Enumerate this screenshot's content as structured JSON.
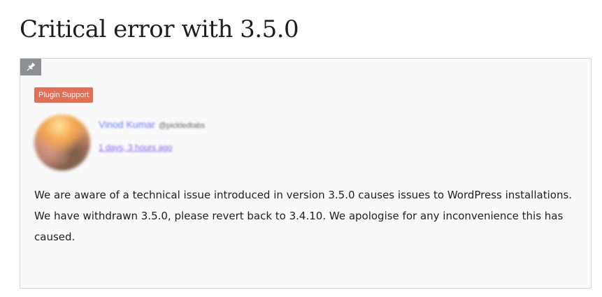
{
  "topic": {
    "title": "Critical error with 3.5.0"
  },
  "reply": {
    "sticky_icon": "pin-icon",
    "badge_label": "Plugin Support",
    "badge_color": "#e26f56",
    "author": {
      "name": "Vinod Kumar",
      "handle": "@pickledtabs",
      "date": "1 days, 3 hours ago"
    },
    "body_text": "We are aware of a technical issue introduced in version 3.5.0 causes issues to WordPress installations. We have withdrawn 3.5.0, please revert back to 3.4.10. We apologise for any inconvenience this has caused."
  }
}
